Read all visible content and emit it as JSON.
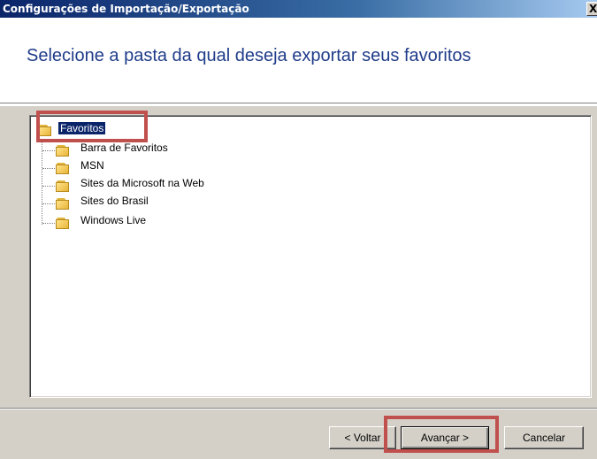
{
  "window": {
    "title": "Configurações de Importação/Exportação",
    "close_glyph": "X"
  },
  "page": {
    "heading": "Selecione a pasta da qual deseja exportar seus favoritos"
  },
  "tree": {
    "root": {
      "label": "Favoritos",
      "icon": "folder-icon",
      "selected": true
    },
    "children": [
      {
        "label": "Barra de Favoritos",
        "icon": "folder-icon"
      },
      {
        "label": "MSN",
        "icon": "folder-icon"
      },
      {
        "label": "Sites da Microsoft na Web",
        "icon": "folder-icon"
      },
      {
        "label": "Sites do Brasil",
        "icon": "folder-icon"
      },
      {
        "label": "Windows Live",
        "icon": "folder-icon"
      }
    ]
  },
  "buttons": {
    "back": "< Voltar",
    "next": "Avançar >",
    "cancel": "Cancelar"
  },
  "colors": {
    "highlight": "#c0504d",
    "heading": "#1f3c8a",
    "dialog": "#d4d0c8",
    "selection": "#0a246a"
  }
}
